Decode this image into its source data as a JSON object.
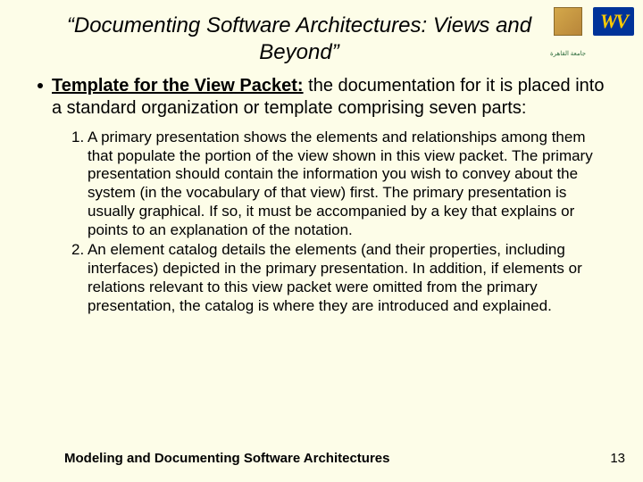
{
  "title": "“Documenting Software Architectures: Views and Beyond”",
  "bullet": {
    "lead": "Template for the View Packet:",
    "rest": " the documentation for it is placed into a standard organization or template comprising seven parts:"
  },
  "items": [
    "1. A primary presentation shows the elements and relationships among them that populate the portion of the view shown in this view packet. The primary presentation should contain the information you wish to convey about the system (in the vocabulary of that view) first. The primary presentation is usually graphical. If so, it must be accompanied by a key that explains or points to an explanation of the notation.",
    "2. An element catalog details the elements (and their properties, including interfaces) depicted in the primary presentation. In addition, if elements or relations relevant to this view packet were omitted from the primary presentation, the catalog is where they are introduced and explained."
  ],
  "footer": "Modeling and Documenting Software Architectures",
  "page": "13",
  "logos": {
    "wv": "WV",
    "cairo": "جامعة القاهرة"
  }
}
